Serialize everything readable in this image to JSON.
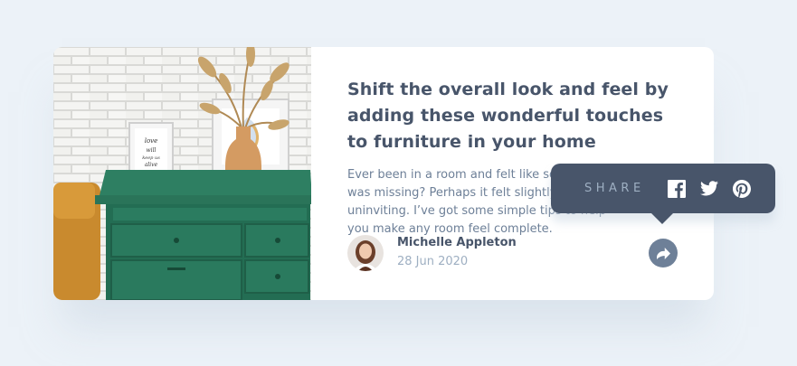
{
  "article": {
    "title": "Shift the overall look and feel by adding these wonderful touches to furniture in your home",
    "description": "Ever been in a room and felt like something was missing? Perhaps it felt slightly bare and uninviting. I’ve got some simple tips to help you make any room feel complete."
  },
  "author": {
    "name": "Michelle Appleton",
    "date": "28 Jun 2020"
  },
  "photo": {
    "frame_text": "love will keep us alive"
  },
  "share": {
    "label": "SHARE",
    "icons": [
      "facebook-icon",
      "twitter-icon",
      "pinterest-icon"
    ],
    "button_icon": "share-arrow-icon"
  },
  "colors": {
    "background": "#ecf2f8",
    "heading": "#48556a",
    "body_text": "#6e8098",
    "muted_text": "#9eafc2",
    "tooltip_bg": "#48556a",
    "card_bg": "#ffffff",
    "dresser_green": "#2a7a5e"
  }
}
